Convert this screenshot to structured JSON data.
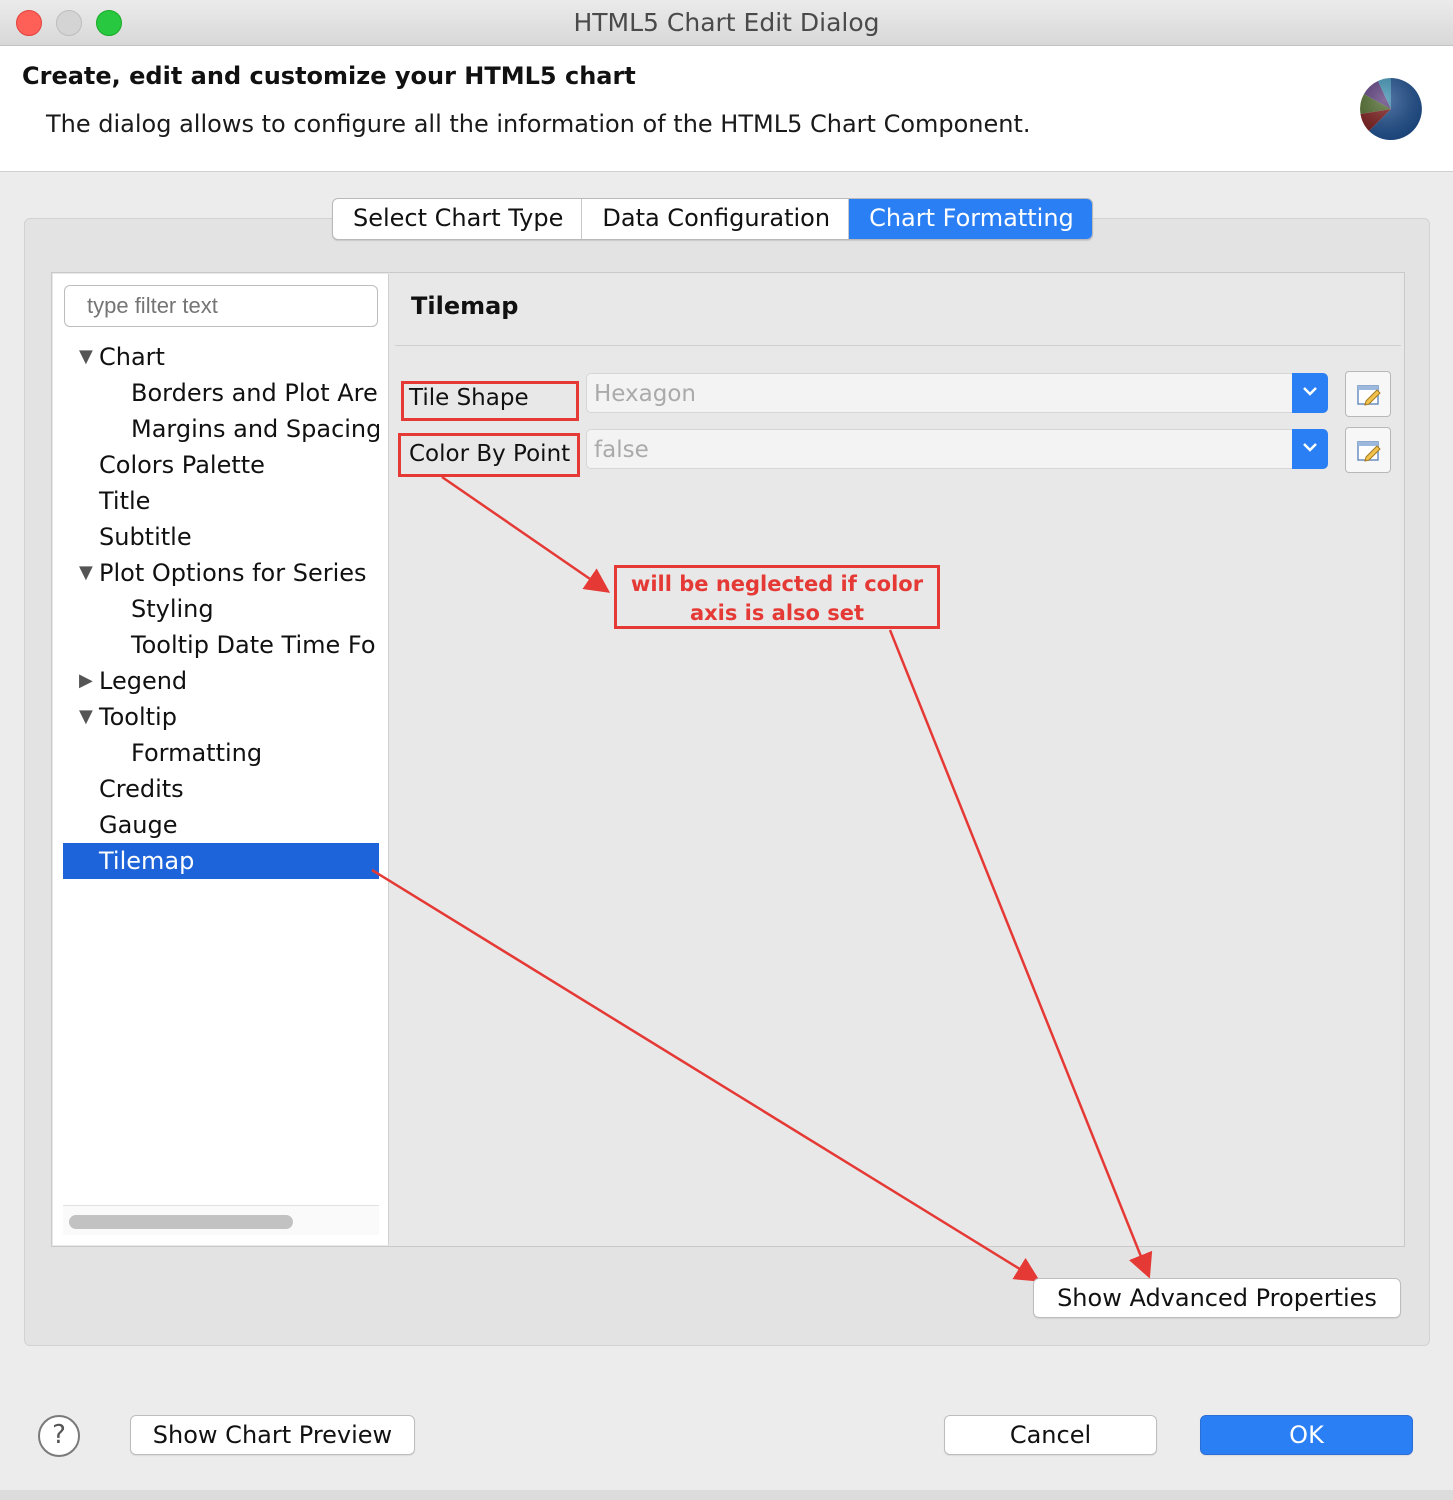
{
  "window": {
    "title": "HTML5 Chart Edit Dialog"
  },
  "header": {
    "title": "Create, edit and customize your HTML5 chart",
    "description": "The dialog allows to configure all the information of the HTML5 Chart Component.",
    "icon": "pie-chart-icon"
  },
  "tabs": [
    {
      "label": "Select Chart Type",
      "active": false
    },
    {
      "label": "Data Configuration",
      "active": false
    },
    {
      "label": "Chart Formatting",
      "active": true
    }
  ],
  "filter": {
    "placeholder": "type filter text"
  },
  "tree": [
    {
      "label": "Chart",
      "level": 0,
      "expander": "expanded"
    },
    {
      "label": "Borders and Plot Are",
      "level": 1
    },
    {
      "label": "Margins and Spacing",
      "level": 1
    },
    {
      "label": "Colors Palette",
      "level": 0
    },
    {
      "label": "Title",
      "level": 0
    },
    {
      "label": "Subtitle",
      "level": 0
    },
    {
      "label": "Plot Options for Series",
      "level": 0,
      "expander": "expanded"
    },
    {
      "label": "Styling",
      "level": 1
    },
    {
      "label": "Tooltip Date Time Fo",
      "level": 1
    },
    {
      "label": "Legend",
      "level": 0,
      "expander": "collapsed"
    },
    {
      "label": "Tooltip",
      "level": 0,
      "expander": "expanded"
    },
    {
      "label": "Formatting",
      "level": 1
    },
    {
      "label": "Credits",
      "level": 0
    },
    {
      "label": "Gauge",
      "level": 0
    },
    {
      "label": "Tilemap",
      "level": 0,
      "selected": true
    }
  ],
  "section": {
    "title": "Tilemap"
  },
  "properties": {
    "tile_shape": {
      "label": "Tile Shape",
      "value": "Hexagon"
    },
    "color_by_point": {
      "label": "Color By Point",
      "value": "false"
    }
  },
  "annotation": {
    "line1": "will be neglected if color",
    "line2": "axis is also set",
    "color": "#e53935"
  },
  "buttons": {
    "show_advanced": "Show Advanced Properties",
    "show_preview": "Show Chart Preview",
    "cancel": "Cancel",
    "ok": "OK",
    "help": "?"
  },
  "colors": {
    "accent": "#2a7ff5",
    "selection": "#1d63d9",
    "annotation": "#e53935"
  }
}
